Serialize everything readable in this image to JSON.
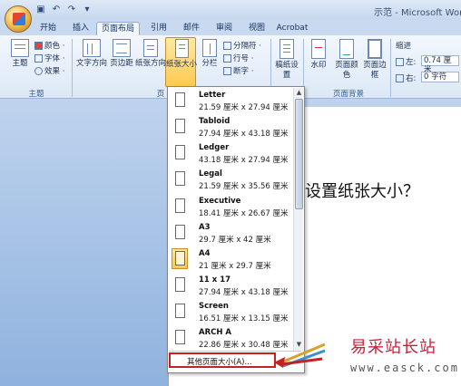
{
  "window": {
    "title": "示范 - Microsoft Word"
  },
  "tabs": [
    {
      "label": "开始"
    },
    {
      "label": "插入"
    },
    {
      "label": "页面布局",
      "active": true
    },
    {
      "label": "引用"
    },
    {
      "label": "邮件"
    },
    {
      "label": "审阅"
    },
    {
      "label": "视图"
    },
    {
      "label": "Acrobat"
    }
  ],
  "ribbon": {
    "theme_group": {
      "label": "主题",
      "theme_btn": "主题",
      "colors_btn": "颜色 ·",
      "fonts_btn": "字体 ·",
      "effects_btn": "效果 ·"
    },
    "page_setup": {
      "label": "页",
      "text_direction": "文字方向",
      "margins": "页边距",
      "orientation": "纸张方向",
      "size": "纸张大小",
      "columns": "分栏",
      "breaks": "分隔符 ·",
      "line_numbers": "行号 ·",
      "hyphenation": "断字 ·"
    },
    "manuscript": {
      "label": "稿纸设置"
    },
    "page_background": {
      "label": "页面背景",
      "watermark": "水印",
      "page_color": "页面颜色",
      "page_borders": "页面边框"
    },
    "paragraph": {
      "indent_label": "缩进",
      "left_label": "左:",
      "left_value": "0.74 厘米",
      "right_label": "右:",
      "right_value": "0 字符"
    }
  },
  "page_sizes": [
    {
      "name": "Letter",
      "dims": "21.59 厘米 x 27.94 厘米"
    },
    {
      "name": "Tabloid",
      "dims": "27.94 厘米 x 43.18 厘米"
    },
    {
      "name": "Ledger",
      "dims": "43.18 厘米 x 27.94 厘米"
    },
    {
      "name": "Legal",
      "dims": "21.59 厘米 x 35.56 厘米"
    },
    {
      "name": "Executive",
      "dims": "18.41 厘米 x 26.67 厘米"
    },
    {
      "name": "A3",
      "dims": "29.7 厘米 x 42 厘米"
    },
    {
      "name": "A4",
      "dims": "21 厘米 x 29.7 厘米",
      "selected": true
    },
    {
      "name": "11 x 17",
      "dims": "27.94 厘米 x 43.18 厘米"
    },
    {
      "name": "Screen",
      "dims": "16.51 厘米 x 13.15 厘米"
    },
    {
      "name": "ARCH A",
      "dims": "22.86 厘米 x 30.48 厘米"
    }
  ],
  "more_sizes": "其他页面大小(A)...",
  "document": {
    "text": "设置纸张大小？"
  },
  "watermark": {
    "text": "易采站长站",
    "url": "www.easck.com"
  },
  "colors": {
    "accent": "#ffc94f",
    "highlight_border": "#c62020"
  }
}
